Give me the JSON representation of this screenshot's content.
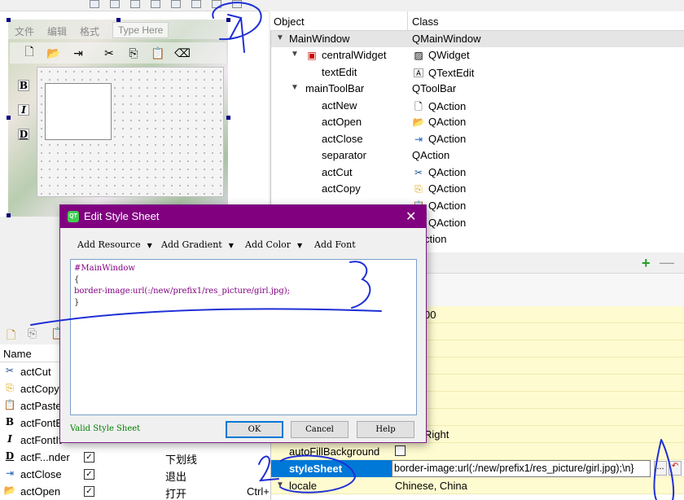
{
  "form": {
    "menus": [
      "文件",
      "编辑",
      "格式"
    ],
    "type_here": "Type Here",
    "side_buttons": [
      "B",
      "I",
      "D"
    ]
  },
  "object_inspector": {
    "columns": [
      "Object",
      "Class"
    ],
    "rows": [
      {
        "name": "MainWindow",
        "class": "QMainWindow",
        "icon": "",
        "class_icon": ""
      },
      {
        "name": "centralWidget",
        "class": "QWidget",
        "icon": "widget-icon",
        "class_icon": "widget-class-icon"
      },
      {
        "name": "textEdit",
        "class": "QTextEdit",
        "icon": "",
        "class_icon": "textedit-class-icon"
      },
      {
        "name": "mainToolBar",
        "class": "QToolBar",
        "icon": "",
        "class_icon": ""
      },
      {
        "name": "actNew",
        "class": "QAction",
        "icon": "",
        "class_icon": "new-file-icon"
      },
      {
        "name": "actOpen",
        "class": "QAction",
        "icon": "",
        "class_icon": "folder-icon"
      },
      {
        "name": "actClose",
        "class": "QAction",
        "icon": "",
        "class_icon": "exit-icon"
      },
      {
        "name": "separator",
        "class": "QAction",
        "icon": "",
        "class_icon": ""
      },
      {
        "name": "actCut",
        "class": "QAction",
        "icon": "",
        "class_icon": "scissors-icon"
      },
      {
        "name": "actCopy",
        "class": "QAction",
        "icon": "",
        "class_icon": "copy-icon"
      },
      {
        "name": "",
        "class": "QAction",
        "icon": "",
        "class_icon": "paste-icon"
      },
      {
        "name": "",
        "class": "QAction",
        "icon": "",
        "class_icon": "eraser-icon"
      },
      {
        "name": "",
        "class": "ction",
        "icon": "",
        "class_icon": ""
      }
    ]
  },
  "property_editor": {
    "rows": [
      {
        "name": "",
        "value": "00"
      },
      {
        "name": "",
        "value": ""
      },
      {
        "name": "",
        "value": ""
      },
      {
        "name": "",
        "value": ""
      },
      {
        "name": "",
        "value": ""
      },
      {
        "name": "",
        "value": ""
      },
      {
        "name": "",
        "value": ""
      },
      {
        "name": "",
        "value": "Right"
      },
      {
        "name": "autoFillBackground",
        "value": ""
      }
    ],
    "stylesheet_label": "styleSheet",
    "stylesheet_value": "border-image:url(:/new/prefix1/res_picture/girl.jpg);\\n}",
    "dots": "...",
    "locale_label": "locale",
    "locale_value": "Chinese, China"
  },
  "action_editor": {
    "column_name": "Name",
    "rows": [
      {
        "name": "actCut",
        "checked": false,
        "text": "",
        "shortcut": "",
        "icon": "scissors-icon"
      },
      {
        "name": "actCopy",
        "checked": false,
        "text": "",
        "shortcut": "",
        "icon": "copy-icon"
      },
      {
        "name": "actPaste",
        "checked": false,
        "text": "",
        "shortcut": "",
        "icon": "paste-icon"
      },
      {
        "name": "actFontB",
        "checked": false,
        "text": "",
        "shortcut": "",
        "icon": "bold-icon"
      },
      {
        "name": "actFontIt",
        "checked": false,
        "text": "",
        "shortcut": "",
        "icon": "italic-icon"
      },
      {
        "name": "actF...nder",
        "checked": true,
        "text": "下划线",
        "shortcut": "",
        "icon": "underline-icon"
      },
      {
        "name": "actClose",
        "checked": true,
        "text": "退出",
        "shortcut": "",
        "icon": "exit-icon"
      },
      {
        "name": "actOpen",
        "checked": true,
        "text": "打开",
        "shortcut": "Ctrl+",
        "icon": "folder-icon"
      }
    ]
  },
  "dialog": {
    "title": "Edit Style Sheet",
    "toolbar": [
      "Add Resource",
      "Add Gradient",
      "Add Color",
      "Add Font"
    ],
    "code_lines": [
      "#MainWindow",
      "{",
      "border-image:url(:/new/prefix1/res_picture/girl.jpg);",
      "}"
    ],
    "status": "Valid Style Sheet",
    "ok": "OK",
    "cancel": "Cancel",
    "help": "Help",
    "close": "✕"
  },
  "annotations": [
    "1",
    "2",
    "3"
  ],
  "colors": {
    "selection": "#0078d7",
    "dialog_title": "#800080",
    "annotation": "#1f2fd6",
    "property_bg": "#fffbd0"
  }
}
